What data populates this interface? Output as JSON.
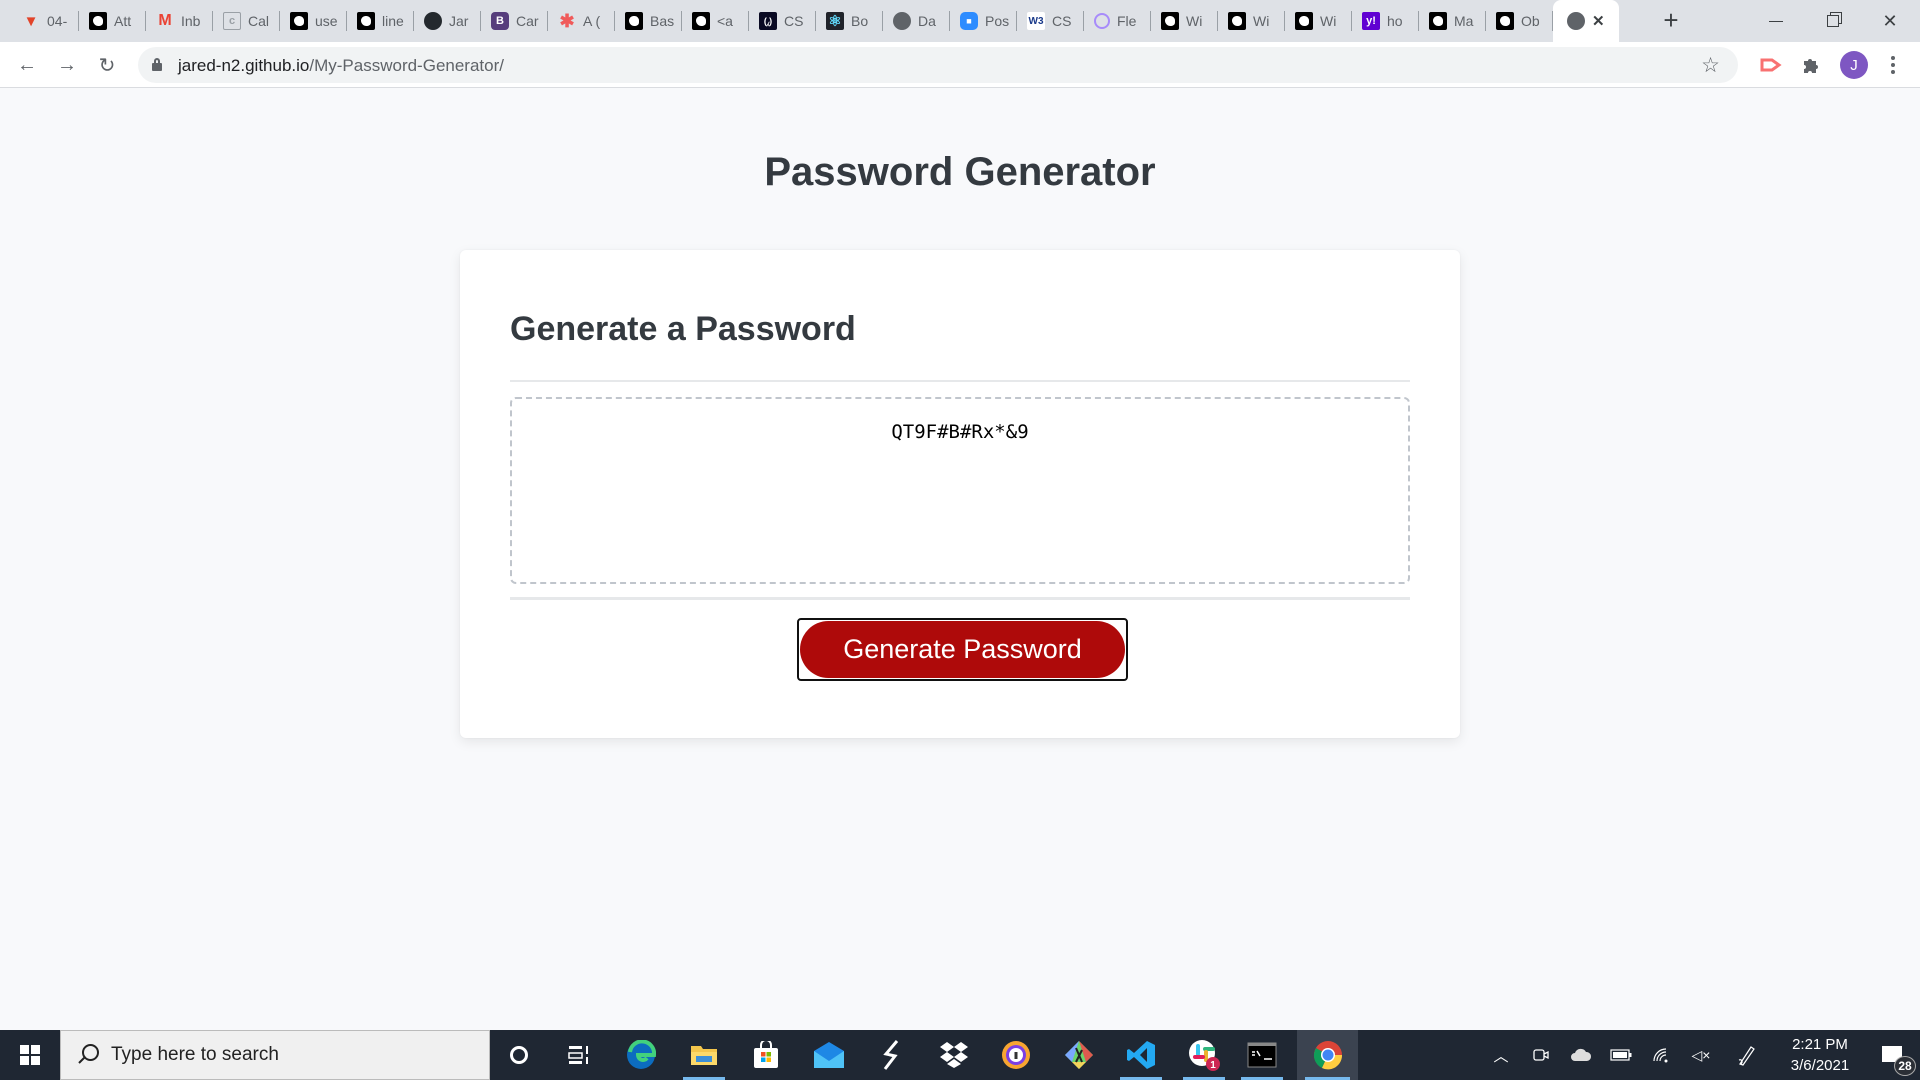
{
  "browser": {
    "tabs": [
      {
        "label": "04-",
        "icon": "gitlab-icon",
        "color": "#e24329"
      },
      {
        "label": "Att",
        "icon": "github-octocat-bw-icon",
        "color": "#000000"
      },
      {
        "label": "Inb",
        "icon": "gmail-icon",
        "color": "#ea4335"
      },
      {
        "label": "Cal",
        "icon": "calendar-icon",
        "color": "#9aa0a6"
      },
      {
        "label": "use",
        "icon": "github-octocat-bw-icon",
        "color": "#000000"
      },
      {
        "label": "line",
        "icon": "github-octocat-bw-icon",
        "color": "#000000"
      },
      {
        "label": "Jar",
        "icon": "github-icon",
        "color": "#24292e"
      },
      {
        "label": "Car",
        "icon": "bootstrap-icon",
        "color": "#563d7c"
      },
      {
        "label": "A (",
        "icon": "asterisk-icon",
        "color": "#f05a5a"
      },
      {
        "label": "Bas",
        "icon": "github-octocat-bw-icon",
        "color": "#000000"
      },
      {
        "label": "<a",
        "icon": "github-octocat-bw-icon",
        "color": "#000000"
      },
      {
        "label": "CS",
        "icon": "freecodecamp-icon",
        "color": "#0a0a23"
      },
      {
        "label": "Bo",
        "icon": "react-icon",
        "color": "#61dafb"
      },
      {
        "label": "Da",
        "icon": "globe-icon",
        "color": "#5f6368"
      },
      {
        "label": "Pos",
        "icon": "zoom-video-icon",
        "color": "#2d8cff"
      },
      {
        "label": "CS",
        "icon": "w3schools-icon",
        "color": "#04aa6d"
      },
      {
        "label": "Fle",
        "icon": "ring-icon",
        "color": "#a78bfa"
      },
      {
        "label": "Wi",
        "icon": "github-octocat-bw-icon",
        "color": "#000000"
      },
      {
        "label": "Wi",
        "icon": "github-octocat-bw-icon",
        "color": "#000000"
      },
      {
        "label": "Wi",
        "icon": "github-octocat-bw-icon",
        "color": "#000000"
      },
      {
        "label": "ho",
        "icon": "yahoo-icon",
        "color": "#6001d2"
      },
      {
        "label": "Ma",
        "icon": "github-octocat-bw-icon",
        "color": "#000000"
      },
      {
        "label": "Ob",
        "icon": "github-octocat-bw-icon",
        "color": "#000000"
      }
    ],
    "active_tab": {
      "icon": "globe-icon",
      "close_glyph": "✕"
    },
    "new_tab_glyph": "+",
    "window_controls": {
      "minimize": "—",
      "restore": "❐",
      "close": "✕"
    },
    "url_host": "jared-n2.github.io",
    "url_path": "/My-Password-Generator/",
    "avatar_initial": "J",
    "avatar_color": "#7e57c2"
  },
  "page": {
    "title": "Password Generator",
    "card_title": "Generate a Password",
    "password_value": "QT9F#B#Rx*&9",
    "generate_button": "Generate Password",
    "accent_color": "#ae0a0a"
  },
  "taskbar": {
    "search_placeholder": "Type here to search",
    "apps": [
      {
        "name": "cortana",
        "running": false
      },
      {
        "name": "task-view",
        "running": false
      },
      {
        "name": "edge",
        "running": false
      },
      {
        "name": "file-explorer",
        "running": true
      },
      {
        "name": "microsoft-store",
        "running": false
      },
      {
        "name": "mail",
        "running": false
      },
      {
        "name": "sublime-like-s",
        "running": false
      },
      {
        "name": "dropbox",
        "running": false
      },
      {
        "name": "avast-browser",
        "running": false
      },
      {
        "name": "git-kraken",
        "running": false
      },
      {
        "name": "vscode",
        "running": true
      },
      {
        "name": "slack",
        "running": true,
        "badge": "1"
      },
      {
        "name": "terminal",
        "running": true
      },
      {
        "name": "chrome",
        "running": true,
        "active": true
      }
    ],
    "time": "2:21 PM",
    "date": "3/6/2021",
    "notification_count": "28"
  }
}
